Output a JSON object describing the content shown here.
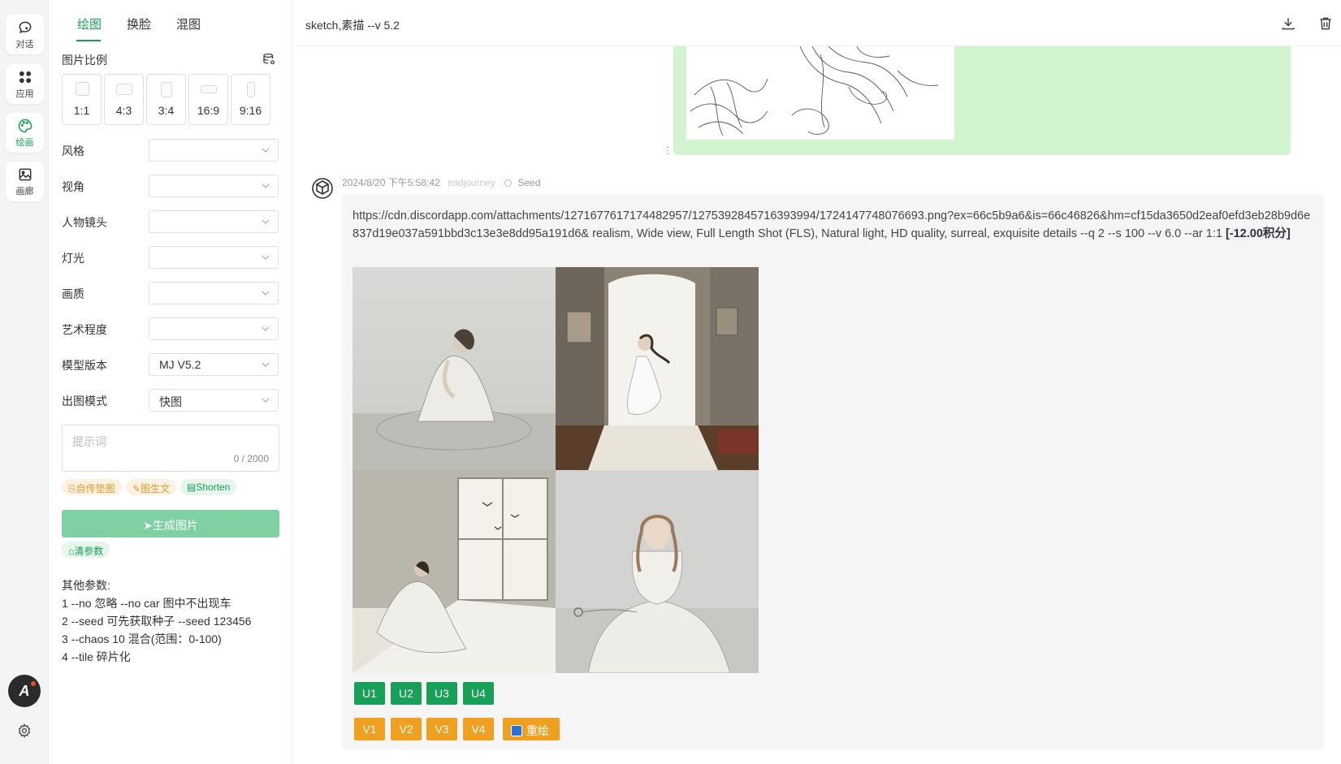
{
  "nav": {
    "items": [
      {
        "label": "对话",
        "icon": "chat-icon"
      },
      {
        "label": "应用",
        "icon": "apps-grid-icon"
      },
      {
        "label": "绘画",
        "icon": "palette-icon"
      },
      {
        "label": "画廊",
        "icon": "image-icon"
      }
    ],
    "active": "绘画",
    "logo_text": "A"
  },
  "panel": {
    "tabs": [
      "绘图",
      "换脸",
      "混图"
    ],
    "active_tab": "绘图",
    "ratio_label": "图片比例",
    "ratios": [
      "1:1",
      "4:3",
      "3:4",
      "16:9",
      "9:16"
    ],
    "fields": [
      {
        "label": "风格",
        "value": ""
      },
      {
        "label": "视角",
        "value": ""
      },
      {
        "label": "人物镜头",
        "value": ""
      },
      {
        "label": "灯光",
        "value": ""
      },
      {
        "label": "画质",
        "value": ""
      },
      {
        "label": "艺术程度",
        "value": ""
      },
      {
        "label": "模型版本",
        "value": "MJ V5.2"
      },
      {
        "label": "出图模式",
        "value": "快图"
      }
    ],
    "prompt_placeholder": "提示词",
    "prompt_counter": "0 / 2000",
    "pills": [
      "自传垫图",
      "图生文",
      "Shorten"
    ],
    "generate_label": "生成图片",
    "clear_label": "清参数",
    "other_title": "其他参数:",
    "other_lines": [
      "1 --no 忽略 --no car 图中不出现车",
      "2 --seed 可先获取种子 --seed 123456",
      "3 --chaos 10 混合(范围：0-100)",
      "4 --tile 碎片化"
    ]
  },
  "main": {
    "title": "sketch,素描 --v 5.2",
    "message": {
      "timestamp": "2024/8/20 下午5:58:42",
      "source": "midjourney",
      "seed_label": "Seed",
      "text": "https://cdn.discordapp.com/attachments/1271677617174482957/1275392845716393994/1724147748076693.png?ex=66c5b9a6&is=66c46826&hm=cf15da3650d2eaf0efd3eb28b9d6e837d19e037a591bbd3c13e3e8dd95a191d6& realism, Wide view, Full Length Shot (FLS), Natural light, HD quality, surreal, exquisite details  --q 2 --s 100  --v 6.0 --ar 1:1 ",
      "cost": "[-12.00积分]",
      "upscale_buttons": [
        "U1",
        "U2",
        "U3",
        "U4"
      ],
      "variation_buttons": [
        "V1",
        "V2",
        "V3",
        "V4"
      ],
      "redraw_label": "重绘"
    }
  }
}
